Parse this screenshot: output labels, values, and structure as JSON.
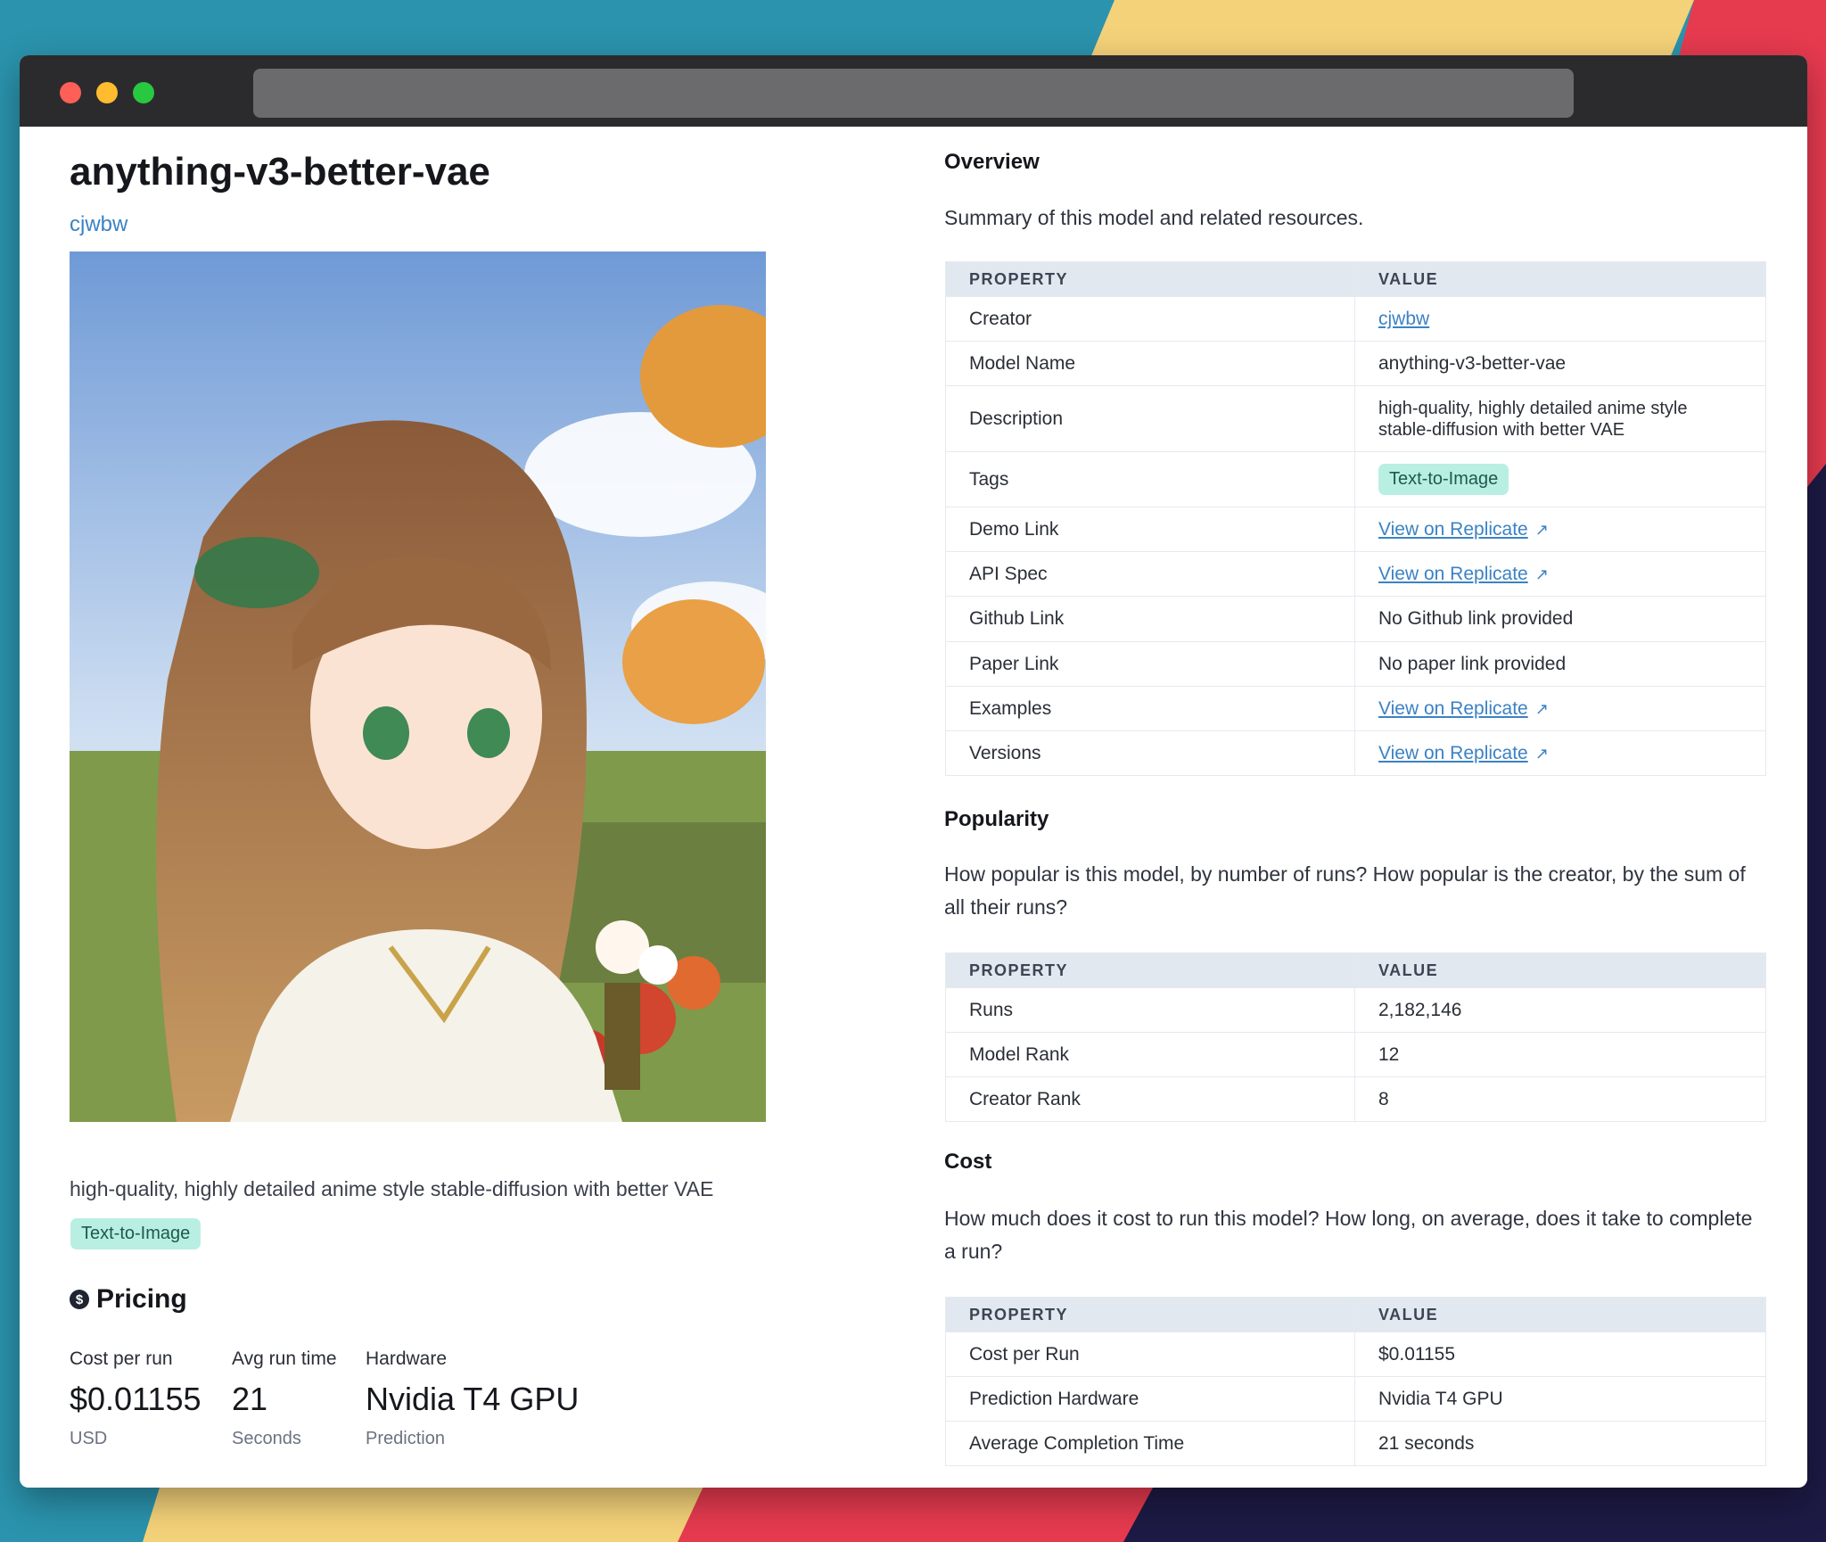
{
  "model": {
    "title": "anything-v3-better-vae",
    "creator": "cjwbw",
    "description": "high-quality, highly detailed anime style stable-diffusion with better VAE",
    "tag": "Text-to-Image"
  },
  "pricing": {
    "heading": "Pricing",
    "coin_symbol": "$",
    "stats": [
      {
        "label": "Cost per run",
        "value": "$0.01155",
        "sub": "USD"
      },
      {
        "label": "Avg run time",
        "value": "21",
        "sub": "Seconds"
      },
      {
        "label": "Hardware",
        "value": "Nvidia T4 GPU",
        "sub": "Prediction"
      }
    ]
  },
  "overview": {
    "title": "Overview",
    "description": "Summary of this model and related resources.",
    "col_property": "PROPERTY",
    "col_value": "VALUE",
    "rows": [
      {
        "property": "Creator",
        "value": "cjwbw"
      },
      {
        "property": "Model Name",
        "value": "anything-v3-better-vae"
      },
      {
        "property": "Description",
        "value": "high-quality, highly detailed anime style stable-diffusion with better VAE"
      },
      {
        "property": "Tags",
        "value": "Text-to-Image"
      },
      {
        "property": "Demo Link",
        "value": "View on Replicate"
      },
      {
        "property": "API Spec",
        "value": "View on Replicate"
      },
      {
        "property": "Github Link",
        "value": "No Github link provided"
      },
      {
        "property": "Paper Link",
        "value": "No paper link provided"
      },
      {
        "property": "Examples",
        "value": "View on Replicate"
      },
      {
        "property": "Versions",
        "value": "View on Replicate"
      }
    ]
  },
  "popularity": {
    "title": "Popularity",
    "description": "How popular is this model, by number of runs? How popular is the creator, by the sum of all their runs?",
    "col_property": "PROPERTY",
    "col_value": "VALUE",
    "rows": [
      {
        "property": "Runs",
        "value": "2,182,146"
      },
      {
        "property": "Model Rank",
        "value": "12"
      },
      {
        "property": "Creator Rank",
        "value": "8"
      }
    ]
  },
  "cost": {
    "title": "Cost",
    "description": "How much does it cost to run this model? How long, on average, does it take to complete a run?",
    "col_property": "PROPERTY",
    "col_value": "VALUE",
    "rows": [
      {
        "property": "Cost per Run",
        "value": "$0.01155"
      },
      {
        "property": "Prediction Hardware",
        "value": "Nvidia T4 GPU"
      },
      {
        "property": "Average Completion Time",
        "value": "21 seconds"
      }
    ]
  },
  "colors": {
    "link": "#3b82c4",
    "tag_bg": "#b9efe3",
    "table_header_bg": "#e2e8f0"
  },
  "icons": {
    "external_link": "external-link-icon",
    "coin": "dollar-coin-icon"
  }
}
